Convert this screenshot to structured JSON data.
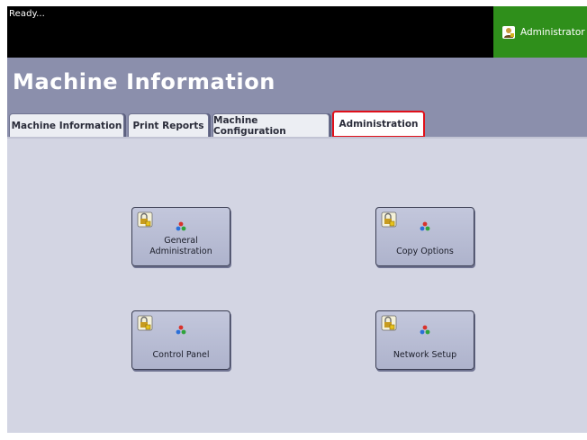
{
  "status": {
    "text": "Ready..."
  },
  "user": {
    "label": "Administrator",
    "icon": "admin-user-icon"
  },
  "header": {
    "title": "Machine Information"
  },
  "tabs": [
    {
      "label": "Machine Information",
      "active": false
    },
    {
      "label": "Print Reports",
      "active": false
    },
    {
      "label": "Machine Configuration",
      "active": false
    },
    {
      "label": "Administration",
      "active": true
    }
  ],
  "tiles": [
    {
      "label": "General\nAdministration",
      "icon": "lock-icon"
    },
    {
      "label": "Copy Options",
      "icon": "lock-icon"
    },
    {
      "label": "Control Panel",
      "icon": "lock-icon"
    },
    {
      "label": "Network Setup",
      "icon": "lock-icon"
    }
  ],
  "colors": {
    "status_bar": "#000000",
    "user_area": "#2f8f1b",
    "title_band": "#8b8fac",
    "content_bg": "#d3d5e3",
    "active_tab_outline": "#e0101a"
  }
}
